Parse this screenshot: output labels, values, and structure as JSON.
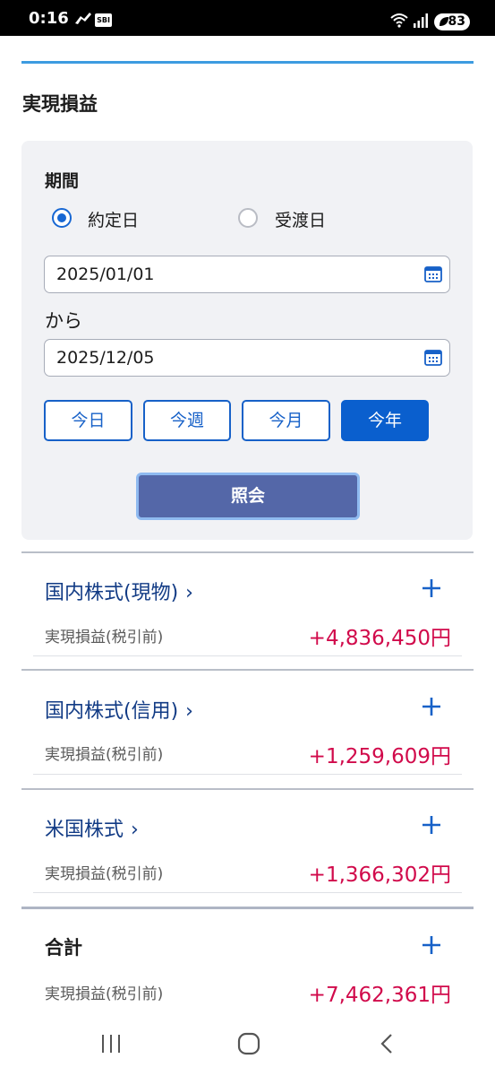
{
  "status_bar": {
    "time": "0:16",
    "app_badge": "SBI",
    "battery": "83",
    "icons": [
      "bull-app-icon",
      "sbi-app-icon",
      "wifi-icon",
      "signal-icon",
      "battery-icon"
    ]
  },
  "page": {
    "title": "実現損益"
  },
  "filter": {
    "period_label": "期間",
    "radio_options": [
      {
        "label": "約定日",
        "selected": true
      },
      {
        "label": "受渡日",
        "selected": false
      }
    ],
    "from_date": "2025/01/01",
    "separator": "から",
    "to_date": "2025/12/05",
    "quick_buttons": [
      {
        "label": "今日",
        "active": false
      },
      {
        "label": "今週",
        "active": false
      },
      {
        "label": "今月",
        "active": false
      },
      {
        "label": "今年",
        "active": true
      }
    ],
    "query_button": "照会"
  },
  "results": [
    {
      "title": "国内株式(現物)",
      "label": "実現損益(税引前)",
      "amount": "+4,836,450円"
    },
    {
      "title": "国内株式(信用)",
      "label": "実現損益(税引前)",
      "amount": "+1,259,609円"
    },
    {
      "title": "米国株式",
      "label": "実現損益(税引前)",
      "amount": "+1,366,302円"
    }
  ],
  "total": {
    "title": "合計",
    "label": "実現損益(税引前)",
    "amount": "+7,462,361円"
  },
  "colors": {
    "accent": "#3d9be0",
    "primary": "#0a5fce",
    "link": "#123b85",
    "profit": "#d10a4b",
    "query_button": "#5467a8"
  }
}
